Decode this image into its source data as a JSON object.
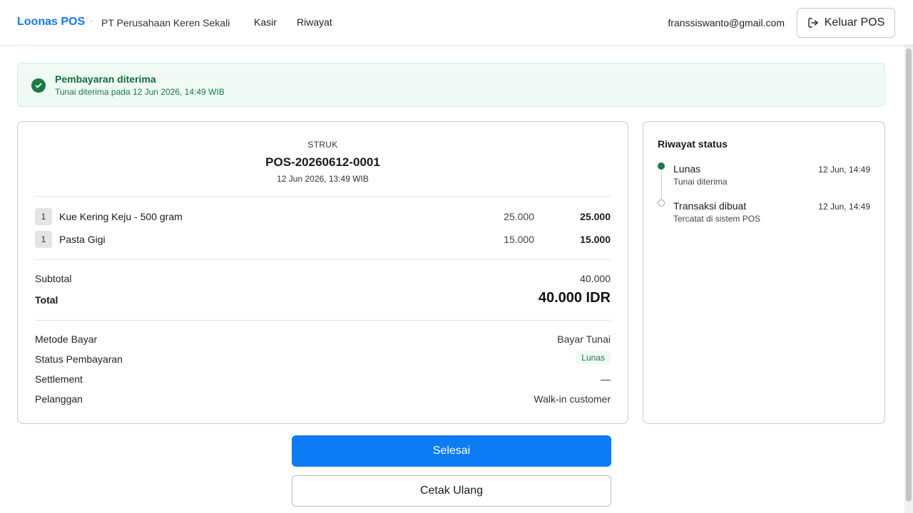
{
  "header": {
    "brand": "Loonas POS",
    "separator": "·",
    "company": "PT Perusahaan Keren Sekali",
    "nav": [
      {
        "label": "Kasir"
      },
      {
        "label": "Riwayat"
      }
    ],
    "user_email": "franssiswanto@gmail.com",
    "logout_label": "Keluar POS",
    "logout_icon": "logout-icon"
  },
  "banner": {
    "icon": "check-circle-icon",
    "title": "Pembayaran diterima",
    "subtitle": "Tunai diterima pada 12 Jun 2026, 14:49 WIB",
    "color": "#1b7a45"
  },
  "receipt": {
    "label": "STRUK",
    "number": "POS-20260612-0001",
    "date": "12 Jun 2026, 13:49 WIB",
    "items": [
      {
        "qty": "1",
        "name": "Kue Kering Keju - 500 gram",
        "price": "25.000",
        "total": "25.000"
      },
      {
        "qty": "1",
        "name": "Pasta Gigi",
        "price": "15.000",
        "total": "15.000"
      }
    ],
    "subtotal_label": "Subtotal",
    "subtotal_value": "40.000",
    "total_label": "Total",
    "total_value": "40.000 IDR",
    "details": {
      "method_label": "Metode Bayar",
      "method_value": "Bayar Tunai",
      "status_label": "Status Pembayaran",
      "status_value": "Lunas",
      "settlement_label": "Settlement",
      "settlement_value": "—",
      "customer_label": "Pelanggan",
      "customer_value": "Walk-in customer"
    }
  },
  "timeline": {
    "title": "Riwayat status",
    "events": [
      {
        "name": "Lunas",
        "desc": "Tunai diterima",
        "time": "12 Jun, 14:49"
      },
      {
        "name": "Transaksi dibuat",
        "desc": "Tercatat di sistem POS",
        "time": "12 Jun, 14:49"
      }
    ]
  },
  "actions": {
    "done_label": "Selesai",
    "reprint_label": "Cetak Ulang"
  },
  "colors": {
    "accent": "#0c7bf4",
    "brand": "#1677e8",
    "success": "#1b7a45",
    "success_bg": "#eefaf3"
  }
}
